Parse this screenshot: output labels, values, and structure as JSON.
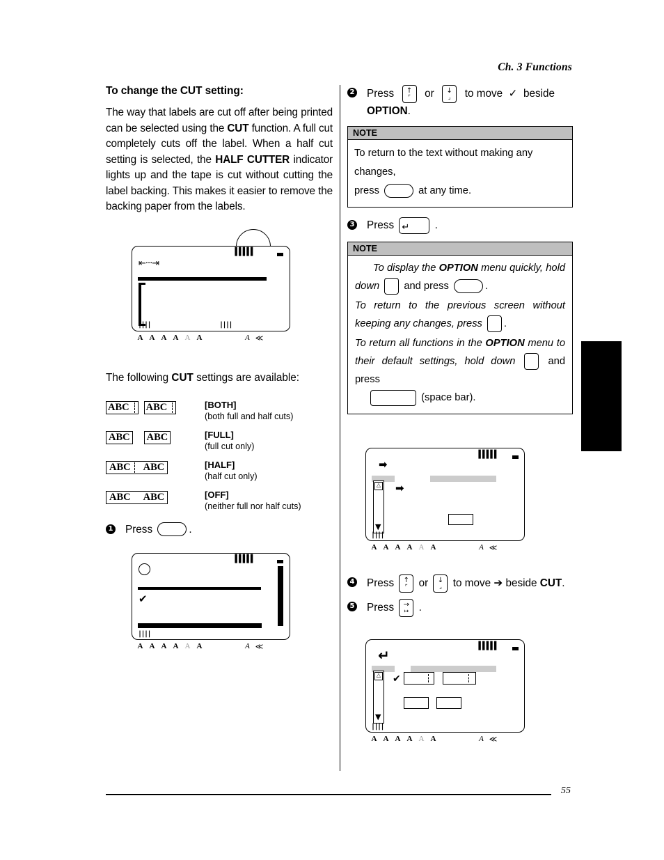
{
  "header": {
    "chapter": "Ch. 3 Functions"
  },
  "footer": {
    "page_number": "55"
  },
  "left": {
    "heading": "To change the CUT setting:",
    "paragraph_parts": {
      "p1": "The way that labels are cut off after being printed can be selected using the ",
      "b1": "CUT",
      "p2": " function. A full cut completely cuts off the label. When a half cut setting is selected, the ",
      "b2": "HALF CUTTER",
      "p3": " indicator lights up and the tape is cut without cutting the label backing. This makes it easier to remove the backing paper from the labels."
    },
    "settings_lead": {
      "pre": "The following ",
      "bold": "CUT",
      "post": " settings are available:"
    },
    "cut_settings": [
      {
        "name": "[BOTH]",
        "desc": "(both full and half cuts)",
        "style": "both",
        "label_text": "ABC"
      },
      {
        "name": "[FULL]",
        "desc": "(full cut only)",
        "style": "full",
        "label_text": "ABC"
      },
      {
        "name": "[HALF]",
        "desc": "(half cut only)",
        "style": "half",
        "label_text": "ABC"
      },
      {
        "name": "[OFF]",
        "desc": "(neither full nor half cuts)",
        "style": "off",
        "label_text": "ABC"
      }
    ],
    "step1": {
      "num": "❶",
      "press": "Press",
      "key": "oval-blank-key",
      "period": "."
    }
  },
  "right": {
    "step2": {
      "num": "❷",
      "text_press": "Press",
      "key_up": "up-arrow-key",
      "text_or": "or",
      "key_down": "down-arrow-key",
      "text_to_move": "to  move",
      "check": "✓",
      "text_beside": "beside",
      "target": "OPTION",
      "period": "."
    },
    "note1": {
      "title": "NOTE",
      "line_a": "To return to the text without making any changes,",
      "line_b_pre": "press",
      "line_b_post": "at any time."
    },
    "step3": {
      "num": "❸",
      "press": "Press",
      "key": "enter-key",
      "period": "."
    },
    "note2": {
      "title": "NOTE",
      "n1_pre": "To display the ",
      "n1_bold": "OPTION",
      "n1_mid": " menu quickly, hold down",
      "n1_post": "and press",
      "n1_end": ".",
      "n2": "To return to the previous screen without keeping any changes, press",
      "n2_end": ".",
      "n3_pre": "To return all functions in the ",
      "n3_bold": "OPTION",
      "n3_mid": " menu to their default settings, hold down",
      "n3_post": "and press",
      "n3_end": "(space bar)."
    },
    "step4": {
      "num": "❹",
      "text_press": "Press",
      "key_up": "up-arrow-key",
      "text_or": "or",
      "key_down": "down-arrow-key",
      "text_to_move": "to move",
      "arrow": "➔",
      "text_beside": "beside",
      "target": "CUT",
      "period": "."
    },
    "step5": {
      "num": "❺",
      "press": "Press",
      "key": "tab-right-key",
      "period": "."
    }
  },
  "lcd_screens": {
    "screen1": {
      "name": "text-entry-screen",
      "tape_indicator": "▐▐▐▐▐",
      "battery": "battery-icon",
      "length_glyph": "⇤···⇥",
      "tick_left": "||||",
      "tick_mid": "||||",
      "status_icons": [
        "A",
        "A",
        "A",
        "A",
        "A",
        "A",
        "A",
        "≪"
      ]
    },
    "screen2": {
      "name": "function-list-screen",
      "tape_indicator": "▐▐▐▐▐",
      "battery": "battery-icon",
      "circle_glyph": "circle-icon",
      "check_glyph": "✔",
      "tick_left": "||||",
      "status_icons": [
        "A",
        "A",
        "A",
        "A",
        "A",
        "A",
        "A",
        "≪"
      ]
    },
    "screen3": {
      "name": "option-menu-screen",
      "tape_indicator": "▐▐▐▐▐",
      "battery": "battery-icon",
      "arrow_top": "➡",
      "arrow_item": "➡",
      "scroll_up_icon": "tape-icon",
      "scroll_down_icon": "▼",
      "tick_left": "||||",
      "status_icons": [
        "A",
        "A",
        "A",
        "A",
        "A",
        "A",
        "A",
        "≪"
      ]
    },
    "screen4": {
      "name": "cut-setting-screen",
      "tape_indicator": "▐▐▐▐▐",
      "battery": "battery-icon",
      "enter_glyph": "↵",
      "check_glyph": "✔",
      "scroll_up_icon": "tape-icon",
      "scroll_down_icon": "▼",
      "tick_left": "||||",
      "options": [
        "both",
        "full",
        "half",
        "off"
      ],
      "status_icons": [
        "A",
        "A",
        "A",
        "A",
        "A",
        "A",
        "A",
        "≪"
      ]
    }
  },
  "colors": {
    "note_header_grey": "#bfbfbf",
    "lcd_highlight_grey": "#cccccc",
    "ink": "#000000"
  }
}
